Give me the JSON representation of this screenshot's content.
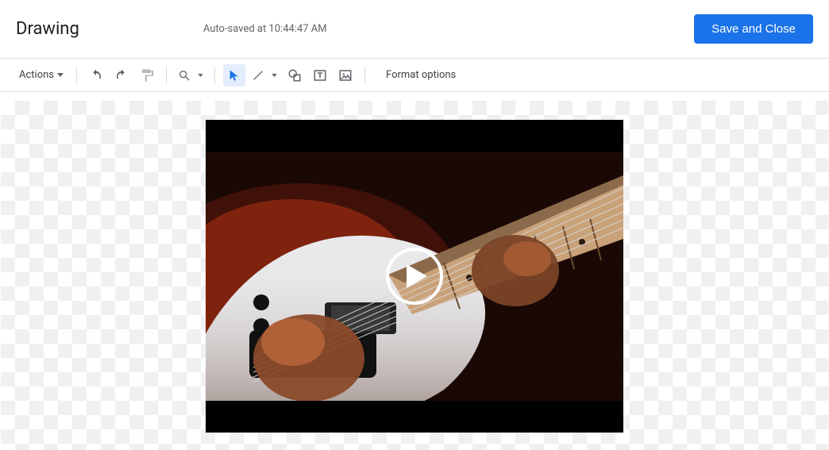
{
  "header": {
    "title": "Drawing",
    "autosave": "Auto-saved at 10:44:47 AM",
    "save_label": "Save and Close"
  },
  "toolbar": {
    "actions_label": "Actions",
    "format_label": "Format options",
    "icons": {
      "undo": "undo-icon",
      "redo": "redo-icon",
      "paint": "paint-format-icon",
      "zoom": "zoom-icon",
      "select": "select-icon",
      "line": "line-icon",
      "shape": "shape-icon",
      "textbox": "text-box-icon",
      "image": "image-icon"
    }
  },
  "canvas": {
    "object": "video-thumbnail",
    "play_icon": "play-icon"
  }
}
